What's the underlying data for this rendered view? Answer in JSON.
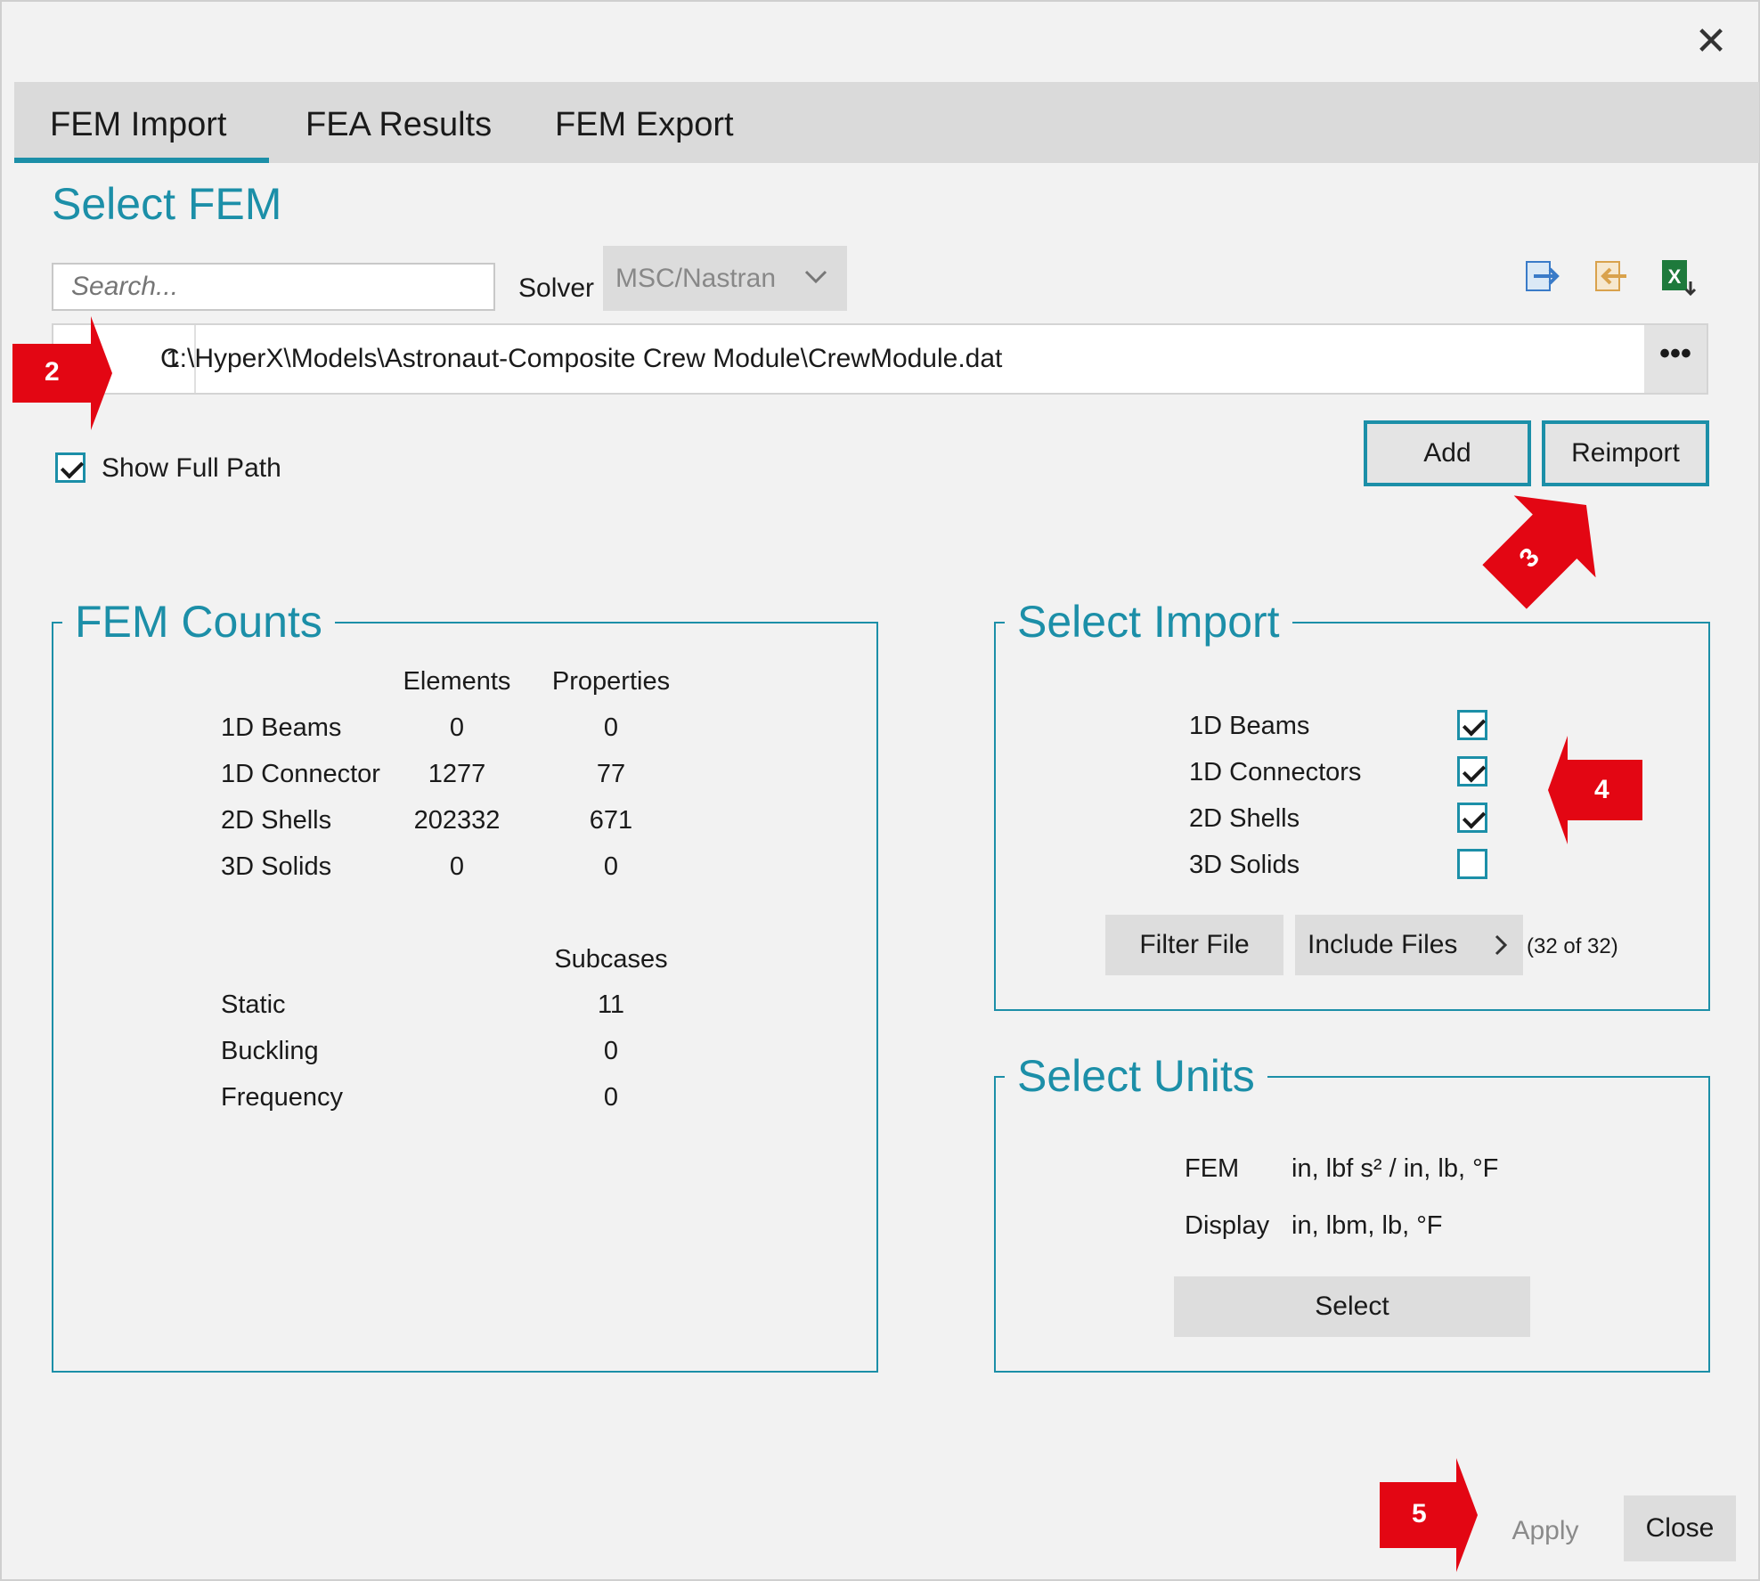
{
  "window": {
    "close_glyph": "✕"
  },
  "tabs": [
    {
      "label": "FEM Import",
      "active": true
    },
    {
      "label": "FEA Results",
      "active": false
    },
    {
      "label": "FEM Export",
      "active": false
    }
  ],
  "select_fem": {
    "title": "Select FEM",
    "search_placeholder": "Search...",
    "solver_label": "Solver",
    "solver_value": "MSC/Nastran",
    "toolbar_icons": [
      "export-arrow-icon",
      "import-arrow-icon",
      "excel-icon"
    ],
    "files": [
      {
        "index": "1",
        "path": "C:\\HyperX\\Models\\Astronaut-Composite Crew Module\\CrewModule.dat"
      }
    ],
    "more_label": "•••",
    "show_full_path_label": "Show Full Path",
    "show_full_path_checked": true,
    "add_label": "Add",
    "reimport_label": "Reimport"
  },
  "fem_counts": {
    "title": "FEM Counts",
    "col_elements": "Elements",
    "col_properties": "Properties",
    "rows": [
      {
        "label": "1D Beams",
        "elements": "0",
        "properties": "0"
      },
      {
        "label": "1D Connector",
        "elements": "1277",
        "properties": "77"
      },
      {
        "label": "2D Shells",
        "elements": "202332",
        "properties": "671"
      },
      {
        "label": "3D Solids",
        "elements": "0",
        "properties": "0"
      }
    ],
    "col_subcases": "Subcases",
    "subcases": [
      {
        "label": "Static",
        "value": "11"
      },
      {
        "label": "Buckling",
        "value": "0"
      },
      {
        "label": "Frequency",
        "value": "0"
      }
    ]
  },
  "select_import": {
    "title": "Select Import",
    "items": [
      {
        "label": "1D Beams",
        "checked": true
      },
      {
        "label": "1D Connectors",
        "checked": true
      },
      {
        "label": "2D Shells",
        "checked": true
      },
      {
        "label": "3D Solids",
        "checked": false
      }
    ],
    "filter_file_label": "Filter File",
    "include_files_label": "Include Files",
    "include_count": "(32 of 32)"
  },
  "select_units": {
    "title": "Select Units",
    "fem_label": "FEM",
    "fem_value": "in, lbf s² / in, lb, °F",
    "display_label": "Display",
    "display_value": "in, lbm, lb, °F",
    "select_label": "Select"
  },
  "footer": {
    "apply_label": "Apply",
    "close_label": "Close"
  },
  "callouts": [
    "2",
    "3",
    "4",
    "5"
  ],
  "colors": {
    "accent": "#1c8fa8",
    "callout_red": "#e30613"
  }
}
